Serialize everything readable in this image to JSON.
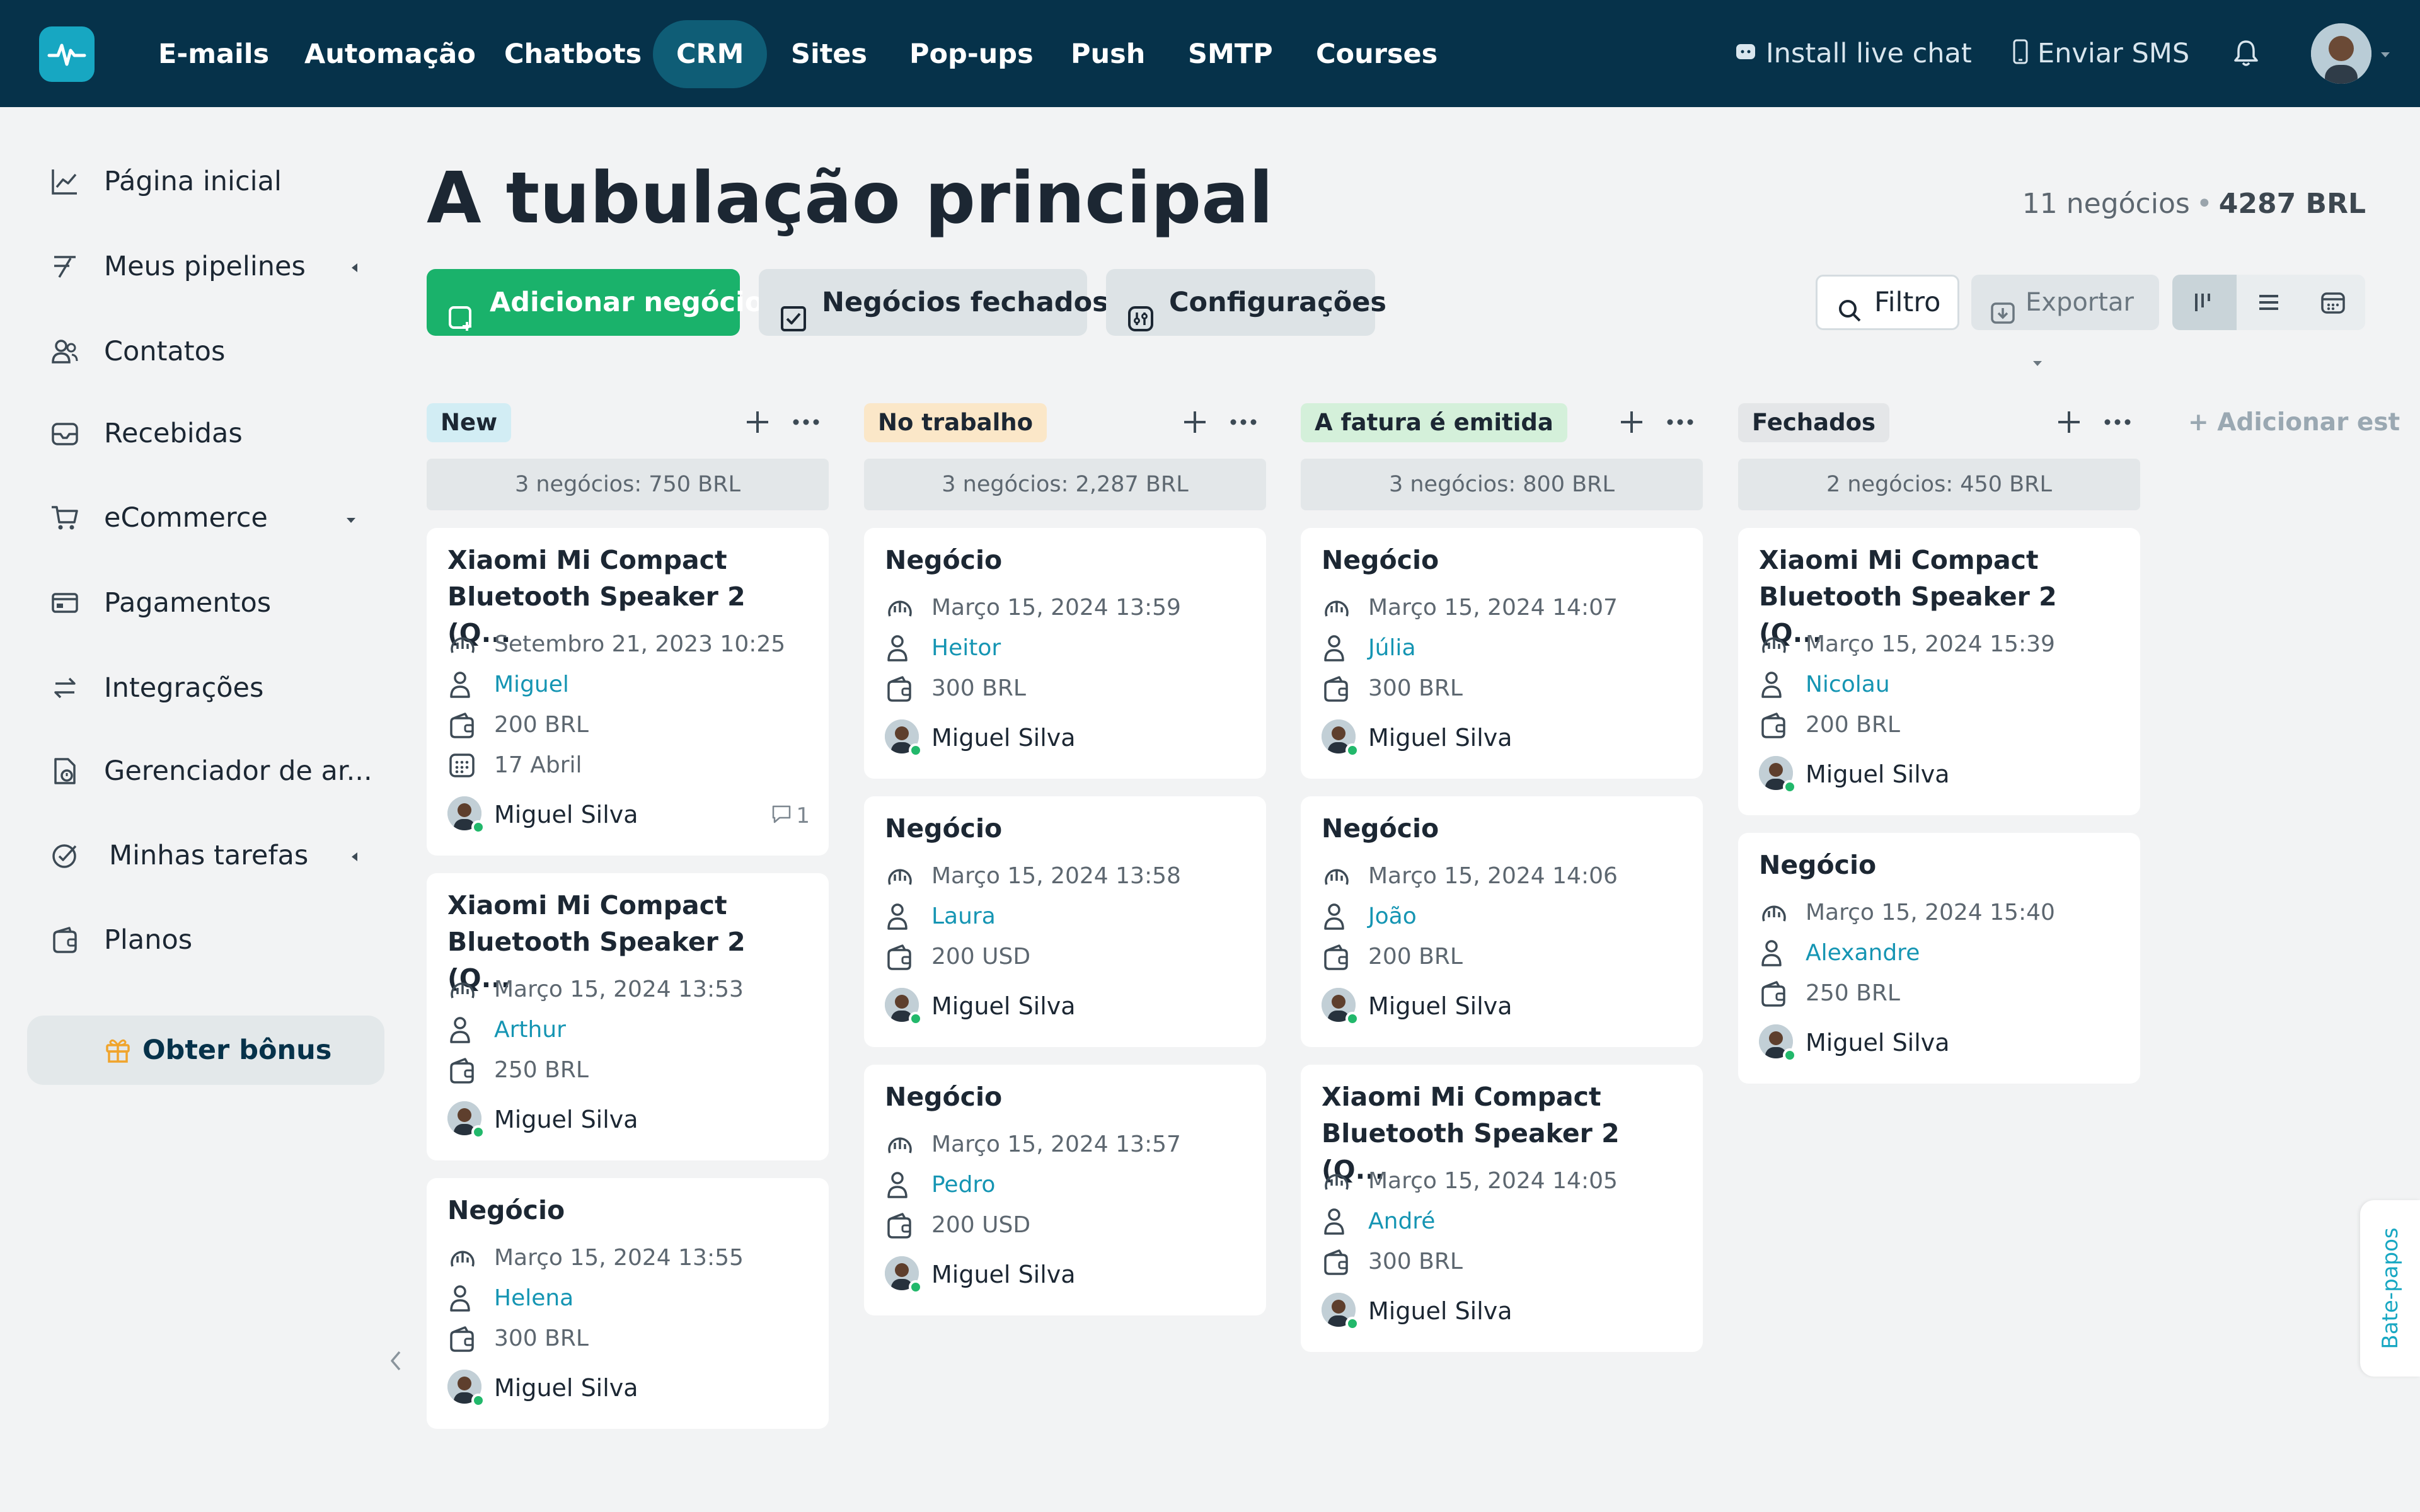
{
  "topbar": {
    "nav": [
      {
        "label": "E-mails"
      },
      {
        "label": "Automação"
      },
      {
        "label": "Chatbots"
      },
      {
        "label": "CRM",
        "active": true
      },
      {
        "label": "Sites"
      },
      {
        "label": "Pop-ups"
      },
      {
        "label": "Push"
      },
      {
        "label": "SMTP"
      },
      {
        "label": "Courses"
      }
    ],
    "live_chat": "Install live chat",
    "sms": "Enviar SMS",
    "brand_color": "#06324a",
    "active_color": "#0f5d76"
  },
  "sidebar": {
    "items": [
      {
        "label": "Página inicial",
        "icon": "chart-line-icon"
      },
      {
        "label": "Meus pipelines",
        "icon": "pipeline-icon"
      },
      {
        "label": "Contatos",
        "icon": "contacts-icon"
      },
      {
        "label": "Recebidas",
        "icon": "inbox-icon"
      },
      {
        "label": "eCommerce",
        "icon": "cart-icon"
      },
      {
        "label": "Pagamentos",
        "icon": "payment-icon"
      },
      {
        "label": "Integrações",
        "icon": "integration-icon"
      },
      {
        "label": "Gerenciador de ar...",
        "icon": "file-manager-icon"
      },
      {
        "label": "Minhas tarefas",
        "icon": "task-icon"
      },
      {
        "label": "Planos",
        "icon": "wallet-icon"
      }
    ],
    "bonus_label": "Obter bônus"
  },
  "header": {
    "title": "A tubulação principal",
    "deals_count": "11 negócios",
    "total": "4287 BRL"
  },
  "toolbar": {
    "add_deal": "Adicionar negócio",
    "closed_deals": "Negócios fechados",
    "settings": "Configurações",
    "filter": "Filtro",
    "export": "Exportar",
    "accent_color": "#1ab26b"
  },
  "add_stage": "+ Adicionar est",
  "chats_tab": "Bate-papos",
  "columns": [
    {
      "name": "New",
      "color": "#d2edf4",
      "summary": "3 negócios: 750 BRL",
      "cards": [
        {
          "title": "Xiaomi Mi Compact Bluetooth Speaker 2 (Q...",
          "date": "Setembro 21, 2023 10:25",
          "contact": "Miguel",
          "amount": "200 BRL",
          "due": "17 Abril",
          "owner": "Miguel Silva",
          "comments": "1"
        },
        {
          "title": "Xiaomi Mi Compact Bluetooth Speaker 2 (Q...",
          "date": "Março 15, 2024 13:53",
          "contact": "Arthur",
          "amount": "250 BRL",
          "owner": "Miguel Silva"
        },
        {
          "title": "Negócio",
          "date": "Março 15, 2024 13:55",
          "contact": "Helena",
          "amount": "300 BRL",
          "owner": "Miguel Silva"
        }
      ]
    },
    {
      "name": "No trabalho",
      "color": "#fbe7c8",
      "summary": "3 negócios: 2,287 BRL",
      "cards": [
        {
          "title": "Negócio",
          "date": "Março 15, 2024 13:59",
          "contact": "Heitor",
          "amount": "300 BRL",
          "owner": "Miguel Silva"
        },
        {
          "title": "Negócio",
          "date": "Março 15, 2024 13:58",
          "contact": "Laura",
          "amount": "200 USD",
          "owner": "Miguel Silva"
        },
        {
          "title": "Negócio",
          "date": "Março 15, 2024 13:57",
          "contact": "Pedro",
          "amount": "200 USD",
          "owner": "Miguel Silva"
        }
      ]
    },
    {
      "name": "A fatura é emitida",
      "color": "#d4f0da",
      "summary": "3 negócios: 800 BRL",
      "cards": [
        {
          "title": "Negócio",
          "date": "Março 15, 2024 14:07",
          "contact": "Júlia",
          "amount": "300 BRL",
          "owner": "Miguel Silva"
        },
        {
          "title": "Negócio",
          "date": "Março 15, 2024 14:06",
          "contact": "João",
          "amount": "200 BRL",
          "owner": "Miguel Silva"
        },
        {
          "title": "Xiaomi Mi Compact Bluetooth Speaker 2 (Q...",
          "date": "Março 15, 2024 14:05",
          "contact": "André",
          "amount": "300 BRL",
          "owner": "Miguel Silva"
        }
      ]
    },
    {
      "name": "Fechados",
      "color": "#e4e6e8",
      "summary": "2 negócios: 450 BRL",
      "cards": [
        {
          "title": "Xiaomi Mi Compact Bluetooth Speaker 2 (Q...",
          "date": "Março 15, 2024 15:39",
          "contact": "Nicolau",
          "amount": "200 BRL",
          "owner": "Miguel Silva"
        },
        {
          "title": "Negócio",
          "date": "Março 15, 2024 15:40",
          "contact": "Alexandre",
          "amount": "250 BRL",
          "owner": "Miguel Silva"
        }
      ]
    }
  ]
}
